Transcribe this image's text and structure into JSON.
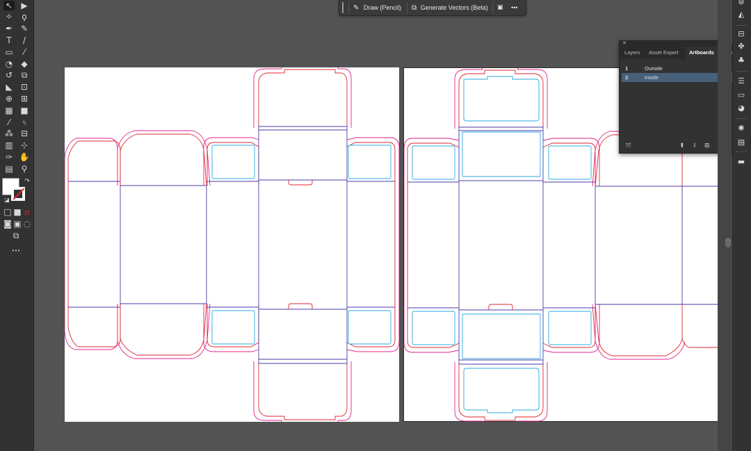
{
  "taskbar": {
    "draw_label": "Draw (Pencil)",
    "generate_label": "Generate Vectors (Beta)",
    "more_label": "•••"
  },
  "artboards_panel": {
    "tabs": [
      "Layers",
      "Asset Export",
      "Artboards"
    ],
    "active_tab": "Artboards",
    "rows": [
      {
        "num": "1",
        "name": "Outside"
      },
      {
        "num": "2",
        "name": "Inside"
      }
    ],
    "selected_row": "2"
  },
  "tools": {
    "more_label": "•••"
  },
  "dieline": {
    "cut_color": "#e0242c",
    "bleed_color": "#e0218a",
    "fold_color": "#4b3aa8",
    "window_color": "#29a9e0"
  }
}
